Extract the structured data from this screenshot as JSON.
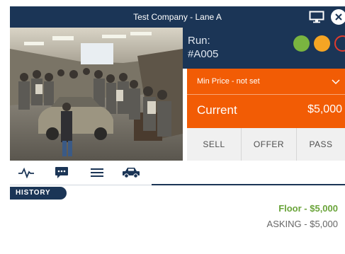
{
  "header": {
    "title": "Test Company - Lane A",
    "monitor_icon": "monitor-icon",
    "close_icon": "close-icon"
  },
  "video": {
    "description_icon": "live-camera-feed"
  },
  "run": {
    "label": "Run:",
    "value": "#A005",
    "status_colors": {
      "green": "#79b440",
      "amber": "#f5a524",
      "red": "#e23b2c"
    }
  },
  "price": {
    "min_price_label": "Min Price - not set",
    "current_label": "Current",
    "current_value": "$5,000"
  },
  "actions": {
    "sell": "SELL",
    "offer": "OFFER",
    "pass": "PASS"
  },
  "tabs": [
    {
      "icon": "activity-icon"
    },
    {
      "icon": "chat-icon"
    },
    {
      "icon": "menu-icon"
    },
    {
      "icon": "car-icon"
    }
  ],
  "history": {
    "badge": "HISTORY",
    "floor": "Floor - $5,000",
    "asking": "ASKING - $5,000"
  },
  "colors": {
    "navy": "#1b3556",
    "orange": "#f25c05",
    "floor_green": "#6aa43a"
  }
}
